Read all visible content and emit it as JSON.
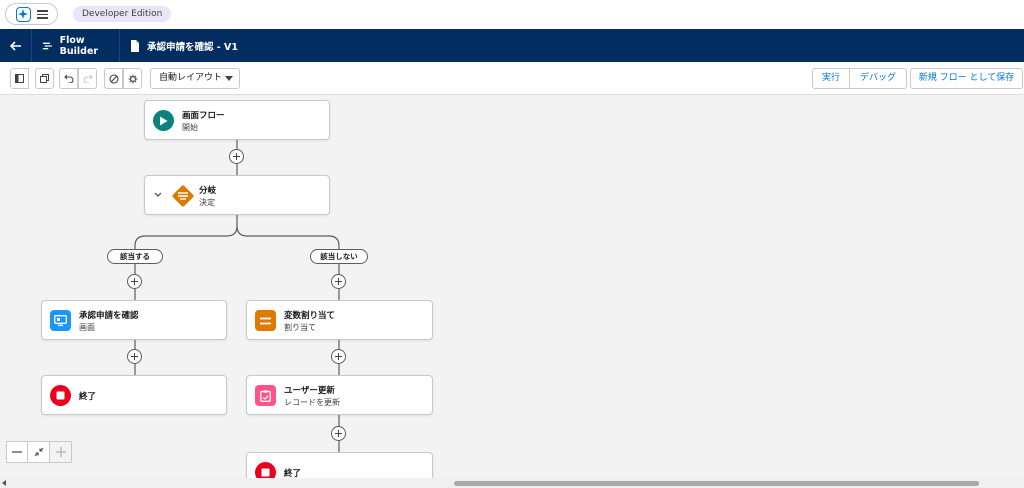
{
  "topbar": {
    "edition": "Developer Edition"
  },
  "nav": {
    "app_name": "Flow Builder",
    "document_title": "承認申請を確認 - V1"
  },
  "toolbar": {
    "layout_select_value": "自動レイアウト",
    "run_label": "実行",
    "debug_label": "デバッグ",
    "save_as_label": "新規 フロー として保存"
  },
  "flow": {
    "start": {
      "title": "画面フロー",
      "subtitle": "開始"
    },
    "decision": {
      "title": "分岐",
      "subtitle": "決定"
    },
    "outcome_true": "該当する",
    "outcome_false": "該当しない",
    "screen": {
      "title": "承認申請を確認",
      "subtitle": "画面"
    },
    "assignment": {
      "title": "変数割り当て",
      "subtitle": "割り当て"
    },
    "update": {
      "title": "ユーザー更新",
      "subtitle": "レコードを更新"
    },
    "end_left": {
      "title": "終了"
    },
    "end_right": {
      "title": "終了"
    }
  },
  "colors": {
    "nav_bg": "#032d60",
    "start_icon": "#0b827c",
    "decision_icon": "#dd7a01",
    "screen_icon": "#1b96ff",
    "assignment_icon": "#dd7a01",
    "update_icon": "#ff538a",
    "end_icon": "#ea001e",
    "link_blue": "#0176d3"
  }
}
